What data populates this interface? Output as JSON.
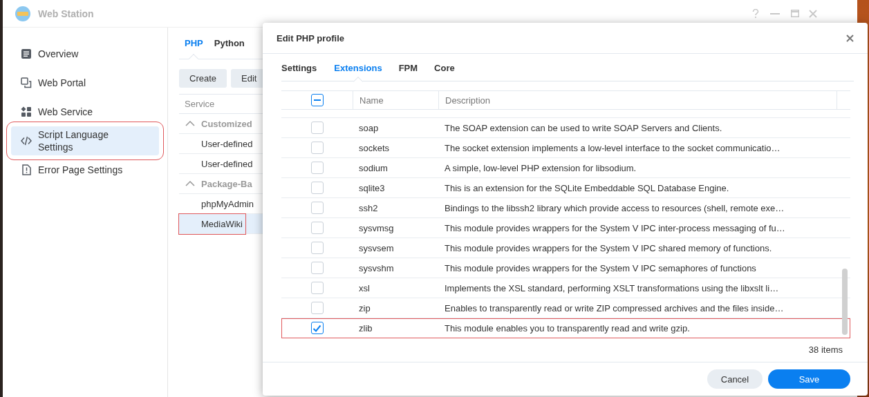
{
  "window": {
    "title": "Web Station"
  },
  "sidebar": {
    "items": [
      {
        "label": "Overview",
        "selected": false,
        "highlighted": false
      },
      {
        "label": "Web Portal",
        "selected": false,
        "highlighted": false
      },
      {
        "label": "Web Service",
        "selected": false,
        "highlighted": false
      },
      {
        "label": "Script Language Settings",
        "selected": true,
        "highlighted": true
      },
      {
        "label": "Error Page Settings",
        "selected": false,
        "highlighted": false
      }
    ]
  },
  "php_panel": {
    "tabs": [
      {
        "label": "PHP",
        "selected": true
      },
      {
        "label": "Python",
        "selected": false
      }
    ],
    "buttons": [
      "Create",
      "Edit"
    ],
    "table": {
      "columns": [
        "Service"
      ],
      "rows": [
        {
          "kind": "group",
          "label": "Customized",
          "expanded": true
        },
        {
          "kind": "item",
          "label": "User-defined",
          "selected": false,
          "highlighted": false
        },
        {
          "kind": "item",
          "label": "User-defined",
          "selected": false,
          "highlighted": false
        },
        {
          "kind": "group",
          "label": "Package-Ba",
          "expanded": true
        },
        {
          "kind": "item",
          "label": "phpMyAdmin",
          "selected": false,
          "highlighted": false
        },
        {
          "kind": "item",
          "label": "MediaWiki",
          "selected": true,
          "highlighted": true
        }
      ]
    }
  },
  "dialog": {
    "title": "Edit PHP profile",
    "tabs": [
      {
        "label": "Settings",
        "selected": false
      },
      {
        "label": "Extensions",
        "selected": true
      },
      {
        "label": "FPM",
        "selected": false
      },
      {
        "label": "Core",
        "selected": false
      }
    ],
    "table": {
      "select_all": {
        "checked": true,
        "partial": true
      },
      "columns": [
        "Name",
        "Description"
      ],
      "rows": [
        {
          "name": "soap",
          "description": "The SOAP extension can be used to write SOAP Servers and Clients.",
          "checked": false,
          "highlighted": false
        },
        {
          "name": "sockets",
          "description": "The socket extension implements a low-level interface to the socket communicatio…",
          "checked": false,
          "highlighted": false
        },
        {
          "name": "sodium",
          "description": "A simple, low-level PHP extension for libsodium.",
          "checked": false,
          "highlighted": false
        },
        {
          "name": "sqlite3",
          "description": "This is an extension for the SQLite Embeddable SQL Database Engine.",
          "checked": false,
          "highlighted": false
        },
        {
          "name": "ssh2",
          "description": "Bindings to the libssh2 library which provide access to resources (shell, remote exe…",
          "checked": false,
          "highlighted": false
        },
        {
          "name": "sysvmsg",
          "description": "This module provides wrappers for the System V IPC inter-process messaging of fu…",
          "checked": false,
          "highlighted": false
        },
        {
          "name": "sysvsem",
          "description": "This module provides wrappers for the System V IPC shared memory of functions.",
          "checked": false,
          "highlighted": false
        },
        {
          "name": "sysvshm",
          "description": "This module provides wrappers for the System V IPC semaphores of functions",
          "checked": false,
          "highlighted": false
        },
        {
          "name": "xsl",
          "description": "Implements the XSL standard, performing XSLT transformations using the libxslt li…",
          "checked": false,
          "highlighted": false
        },
        {
          "name": "zip",
          "description": "Enables to transparently read or write ZIP compressed archives and the files inside…",
          "checked": false,
          "highlighted": false
        },
        {
          "name": "zlib",
          "description": "This module enables you to transparently read and write gzip.",
          "checked": true,
          "highlighted": true
        }
      ]
    },
    "item_count": "38 items",
    "buttons": [
      {
        "label": "Cancel",
        "kind": "secondary"
      },
      {
        "label": "Save",
        "kind": "primary"
      }
    ]
  }
}
